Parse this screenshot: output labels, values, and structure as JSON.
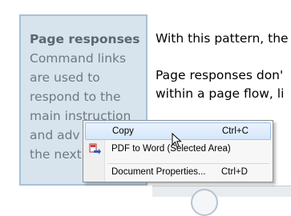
{
  "sidebar": {
    "title": "Page responses",
    "lines": [
      "Command links",
      "are used to",
      "respond to the",
      "main instruction",
      "and adv",
      "the next"
    ]
  },
  "main": {
    "lines": [
      "With this pattern, the",
      "Page responses don'",
      "within a page flow, li"
    ]
  },
  "context_menu": {
    "items": [
      {
        "label": "Copy",
        "shortcut": "Ctrl+C",
        "icon": null,
        "highlighted": true
      },
      {
        "label": "PDF to Word (Selected Area)",
        "shortcut": "",
        "icon": "pdf-to-word-icon",
        "highlighted": false
      },
      {
        "label": "Document Properties...",
        "shortcut": "Ctrl+D",
        "icon": null,
        "highlighted": false
      }
    ]
  },
  "colors": {
    "sidebar_bg": "#d7e4ee",
    "sidebar_border": "#a8c1d6",
    "menu_highlight": "#d5e7fb"
  }
}
